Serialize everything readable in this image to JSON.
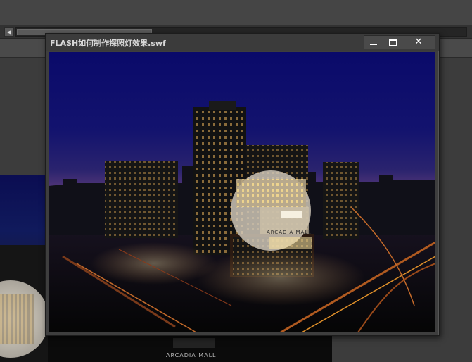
{
  "window": {
    "title": "FLASH如何制作探照灯效果.swf",
    "minimize_icon": "minimize-icon",
    "maximize_icon": "maximize-icon",
    "close_icon": "close-icon",
    "close_glyph": "✕"
  },
  "scrollbar": {
    "left_arrow": "◀"
  },
  "scene": {
    "sign_text": "ARCADIA MALL",
    "sky_top": "#0a0a6a",
    "sky_horizon": "#5b3a7a"
  },
  "bottom_image": {
    "sign_text": "ARCADIA MALL"
  }
}
